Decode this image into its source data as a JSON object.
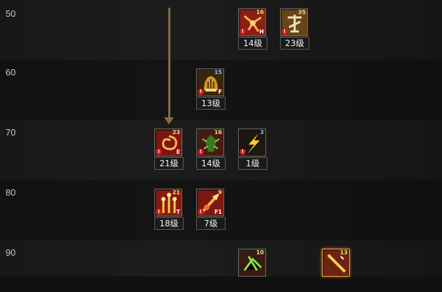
{
  "levels": [
    "50",
    "60",
    "70",
    "80",
    "90"
  ],
  "colors": {
    "icon_red": "#8a1f14",
    "icon_gold": "#c89a2a",
    "icon_green": "#3a7a22",
    "arrow": "#8a6a44"
  },
  "skills": [
    {
      "id": "s50a",
      "level_row": "50",
      "icon": "cracked-rune-icon",
      "num": "16",
      "key": "H",
      "badge": "14级"
    },
    {
      "id": "s50b",
      "level_row": "50",
      "icon": "rune-glyph-icon",
      "num": "35",
      "key": "",
      "badge": "23级"
    },
    {
      "id": "s60a",
      "level_row": "60",
      "icon": "golden-helm-icon",
      "num": "15",
      "key": "F",
      "badge": "13级"
    },
    {
      "id": "s70a",
      "level_row": "70",
      "icon": "crimson-swirl-icon",
      "num": "23",
      "key": "E",
      "badge": "21级"
    },
    {
      "id": "s70b",
      "level_row": "70",
      "icon": "green-beast-icon",
      "num": "16",
      "key": "",
      "badge": "14级"
    },
    {
      "id": "s70c",
      "level_row": "70",
      "icon": "lightning-bolt-icon",
      "num": "3",
      "key": "",
      "badge": "1级"
    },
    {
      "id": "s80a",
      "level_row": "80",
      "icon": "flame-pillars-icon",
      "num": "21",
      "key": "T",
      "badge": "18级"
    },
    {
      "id": "s80b",
      "level_row": "80",
      "icon": "fire-strike-icon",
      "num": "9",
      "key": "F1",
      "badge": "7级"
    },
    {
      "id": "s90a",
      "level_row": "90",
      "icon": "green-shards-icon",
      "num": "10",
      "key": "",
      "badge": ""
    },
    {
      "id": "s90b",
      "level_row": "90",
      "icon": "golden-blade-icon",
      "num": "13",
      "key": "",
      "badge": ""
    }
  ]
}
